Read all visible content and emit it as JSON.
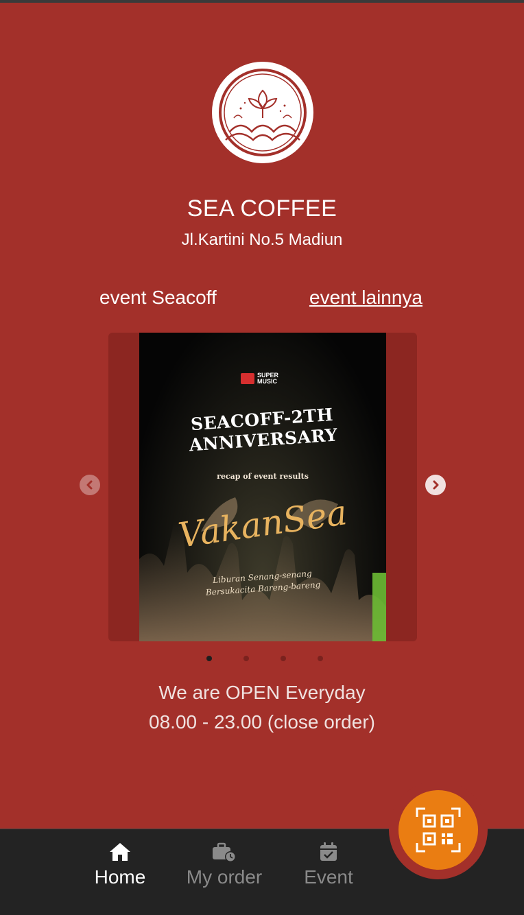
{
  "store": {
    "name": "SEA COFFEE",
    "address": "Jl.Kartini No.5 Madiun"
  },
  "events": {
    "left_label": "event Seacoff",
    "right_link": "event lainnya"
  },
  "carousel": {
    "active_index": 0,
    "slide_count": 4,
    "poster": {
      "brand_line1": "SUPER",
      "brand_line2": "MUSIC",
      "headline_line1": "SEACOFF-2TH",
      "headline_line2": "ANNIVERSARY",
      "recap": "recap of event results",
      "script_title": "VakanSea",
      "tagline_line1": "Liburan Senang-senang",
      "tagline_line2": "Bersukacita Bareng-bareng"
    }
  },
  "hours": {
    "line1": "We are OPEN Everyday",
    "line2": "08.00 - 23.00 (close order)"
  },
  "nav": {
    "items": [
      {
        "label": "Home",
        "icon": "home-icon",
        "active": true
      },
      {
        "label": "My order",
        "icon": "briefcase-clock-icon",
        "active": false
      },
      {
        "label": "Event",
        "icon": "calendar-check-icon",
        "active": false
      }
    ],
    "fab_icon": "qr-scan-icon"
  },
  "colors": {
    "background": "#a3302a",
    "nav_background": "#232323",
    "fab": "#ea7d12",
    "poster_script": "#e8b35f"
  }
}
